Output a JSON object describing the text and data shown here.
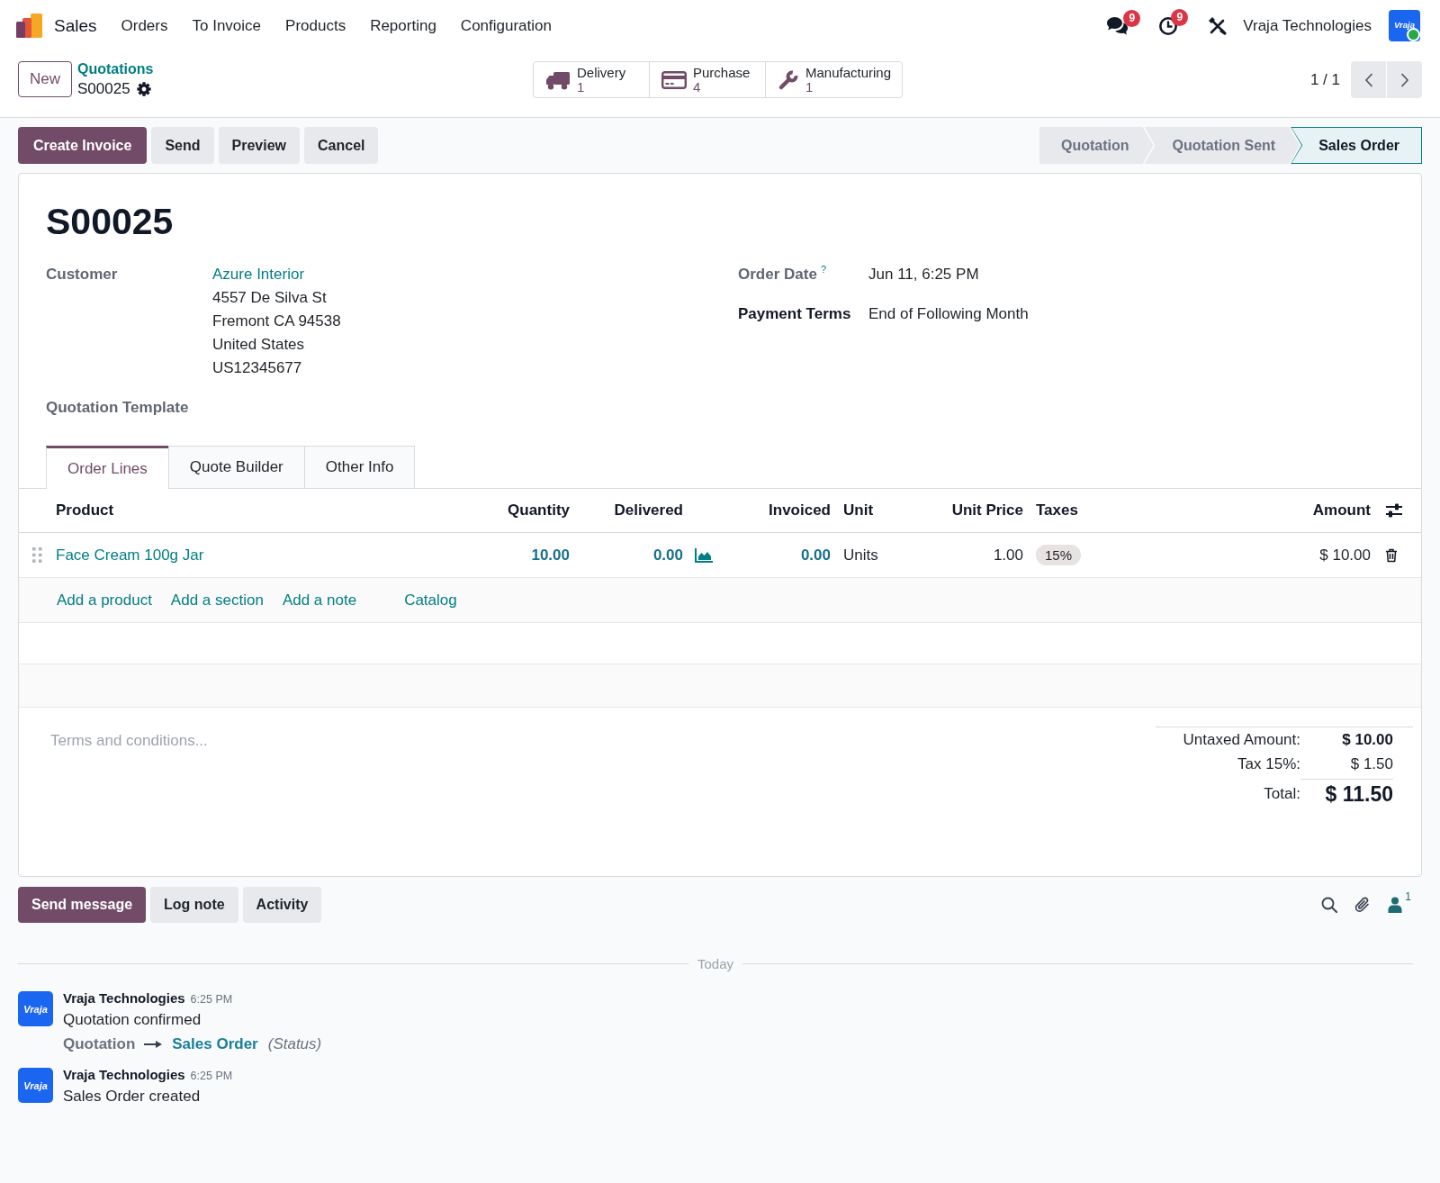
{
  "navbar": {
    "app_name": "Sales",
    "menu": [
      "Orders",
      "To Invoice",
      "Products",
      "Reporting",
      "Configuration"
    ],
    "messages_badge": "9",
    "activities_badge": "9",
    "company": "Vraja Technologies",
    "avatar": {
      "logo_text": "Vraja",
      "online": true
    }
  },
  "control_panel": {
    "new_button": "New",
    "breadcrumb": {
      "parent": "Quotations",
      "current": "S00025"
    },
    "smart_buttons": [
      {
        "kind": "delivery",
        "label": "Delivery",
        "count": "1"
      },
      {
        "kind": "purchase",
        "label": "Purchase",
        "count": "4"
      },
      {
        "kind": "manufacturing",
        "label": "Manufacturing",
        "count": "1"
      }
    ],
    "pager": "1 / 1"
  },
  "action_bar": {
    "buttons": [
      {
        "label": "Create Invoice",
        "primary": true
      },
      {
        "label": "Send",
        "primary": false
      },
      {
        "label": "Preview",
        "primary": false
      },
      {
        "label": "Cancel",
        "primary": false
      }
    ],
    "status_steps": [
      {
        "label": "Quotation",
        "selected": false
      },
      {
        "label": "Quotation Sent",
        "selected": false
      },
      {
        "label": "Sales Order",
        "selected": true
      }
    ]
  },
  "form": {
    "title": "S00025",
    "left_fields": [
      {
        "label": "Customer",
        "emphasized": false,
        "link": "Azure Interior",
        "lines": [
          "4557 De Silva St",
          "Fremont CA 94538",
          "United States",
          "US12345677"
        ]
      },
      {
        "label": "Quotation Template",
        "emphasized": false
      }
    ],
    "right_fields": [
      {
        "label": "Order Date",
        "emphasized": false,
        "help": "?",
        "lines": [
          "Jun 11, 6:25 PM"
        ]
      },
      {
        "label": "Payment Terms",
        "emphasized": true,
        "lines": [
          "End of Following Month"
        ]
      }
    ],
    "tabs": [
      {
        "label": "Order Lines",
        "selected": true
      },
      {
        "label": "Quote Builder",
        "selected": false
      },
      {
        "label": "Other Info",
        "selected": false
      }
    ],
    "order_lines": {
      "columns": [
        {
          "label": "Product",
          "kind": "product"
        },
        {
          "label": "Quantity",
          "kind": "qty"
        },
        {
          "label": "Delivered",
          "kind": "qty_forecast"
        },
        {
          "label": "Invoiced",
          "kind": "qty"
        },
        {
          "label": "Unit",
          "kind": "text"
        },
        {
          "label": "Unit Price",
          "kind": "number"
        },
        {
          "label": "Taxes",
          "kind": "tags"
        },
        {
          "label": "Amount",
          "kind": "number"
        }
      ],
      "rows": [
        {
          "cells": [
            "Face Cream 100g Jar",
            "10.00",
            "0.00",
            "0.00",
            "Units",
            "1.00",
            [
              "15%"
            ],
            "$ 10.00"
          ]
        }
      ],
      "add_links": [
        "Add a product",
        "Add a section",
        "Add a note"
      ],
      "catalog_button": "Catalog"
    },
    "terms": {
      "placeholder": "Terms and conditions..."
    },
    "totals": [
      {
        "kind": "subtotal",
        "label": "Untaxed Amount:",
        "value": "$ 10.00"
      },
      {
        "kind": "tax",
        "label": "Tax 15%:",
        "value": "$ 1.50"
      },
      {
        "kind": "total",
        "label": "Total:",
        "value": "$ 11.50"
      }
    ]
  },
  "chatter": {
    "buttons": [
      {
        "label": "Send message",
        "primary": true
      },
      {
        "label": "Log note",
        "primary": false
      },
      {
        "label": "Activity",
        "primary": false
      }
    ],
    "followers_count": "1",
    "date_separator": "Today",
    "messages": [
      {
        "author": "Vraja Technologies",
        "time": "6:25 PM",
        "avatar_text": "Vraja",
        "body": "Quotation confirmed",
        "tracking": {
          "old_value": "Quotation",
          "new_value": "Sales Order",
          "field": "(Status)"
        }
      },
      {
        "author": "Vraja Technologies",
        "time": "6:25 PM",
        "avatar_text": "Vraja",
        "body": "Sales Order created"
      }
    ]
  }
}
